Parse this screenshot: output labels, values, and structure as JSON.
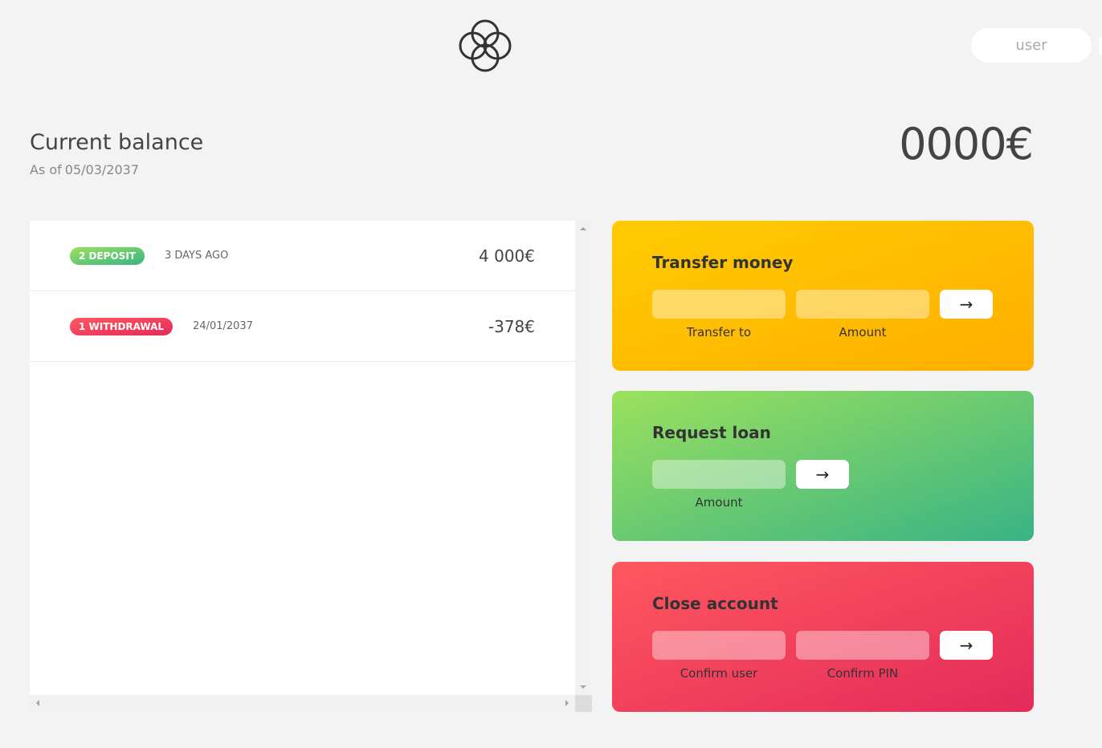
{
  "header": {
    "logo_icon": "four-circles-logo-icon",
    "login": {
      "user_placeholder": "user"
    }
  },
  "balance": {
    "title": "Current balance",
    "date_label": "As of",
    "date_value": "05/03/2037",
    "value": "0000€"
  },
  "movements": [
    {
      "type_label": "2 deposit",
      "type": "deposit",
      "date": "3 days ago",
      "value": "4 000€"
    },
    {
      "type_label": "1 withdrawal",
      "type": "withdrawal",
      "date": "24/01/2037",
      "value": "-378€"
    }
  ],
  "operations": {
    "transfer": {
      "title": "Transfer money",
      "to_label": "Transfer to",
      "amount_label": "Amount",
      "button_label": "→"
    },
    "loan": {
      "title": "Request loan",
      "amount_label": "Amount",
      "button_label": "→"
    },
    "close": {
      "title": "Close account",
      "user_label": "Confirm user",
      "pin_label": "Confirm PIN",
      "button_label": "→"
    }
  },
  "colors": {
    "background": "#f3f3f3",
    "deposit": "#39b385",
    "withdrawal": "#e52a5a",
    "transfer": "#ffb003",
    "loan": "#5fc36f",
    "close": "#f0405c"
  }
}
